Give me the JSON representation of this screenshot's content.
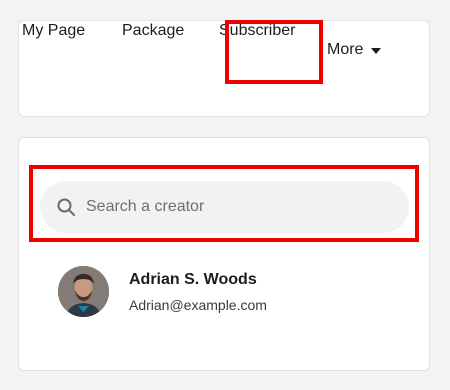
{
  "nav": {
    "items": [
      {
        "label": "My Page"
      },
      {
        "label": "Package"
      },
      {
        "label": "Subscriber"
      },
      {
        "label": "More"
      }
    ]
  },
  "search": {
    "placeholder": "Search a creator",
    "value": ""
  },
  "results": [
    {
      "name": "Adrian S. Woods",
      "email": "Adrian@example.com",
      "avatar": "user-photo"
    }
  ],
  "colors": {
    "highlight": "#ee0000",
    "search_bg": "#f2f2f3",
    "card_bg": "#ffffff",
    "page_bg": "#f3f3f4"
  }
}
